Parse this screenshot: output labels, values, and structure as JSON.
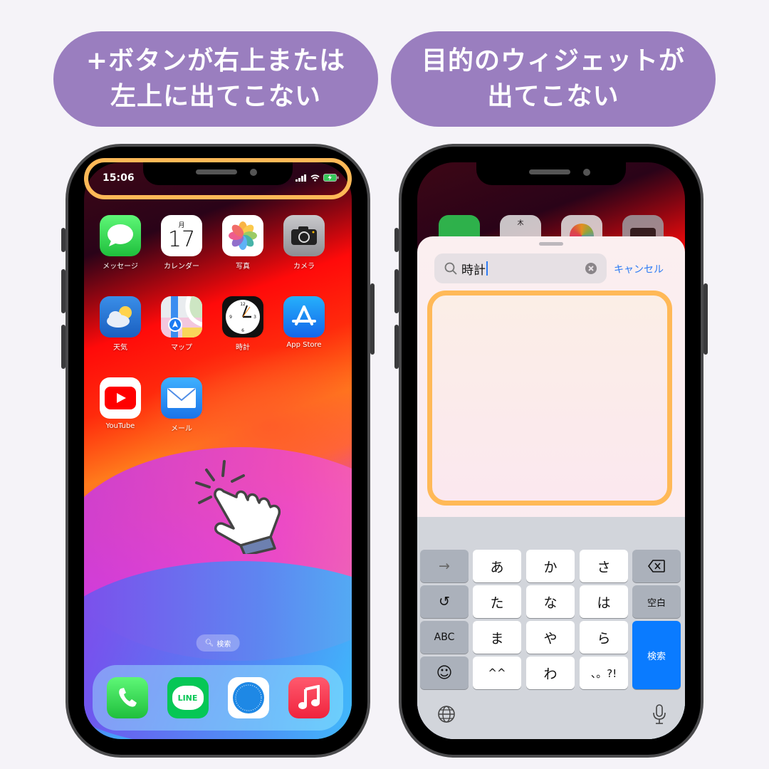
{
  "banners": {
    "left": {
      "line1": "+ボタンが右上または",
      "line2": "左上に出てこない"
    },
    "right": {
      "line1": "目的のウィジェットが",
      "line2": "出てこない"
    }
  },
  "colors": {
    "banner_bg": "#9a7ebf",
    "highlight": "#ffb957",
    "link_blue": "#2d7bf4",
    "search_key_blue": "#0a7bff"
  },
  "phone1": {
    "status_time": "15:06",
    "status_icons": [
      "signal-icon",
      "wifi-icon",
      "battery-charging-icon"
    ],
    "apps": [
      {
        "name": "messages",
        "label": "メッセージ"
      },
      {
        "name": "calendar",
        "label": "カレンダー",
        "day_of_week": "月",
        "date": "17"
      },
      {
        "name": "photos",
        "label": "写真"
      },
      {
        "name": "camera",
        "label": "カメラ"
      },
      {
        "name": "weather",
        "label": "天気"
      },
      {
        "name": "maps",
        "label": "マップ"
      },
      {
        "name": "clock",
        "label": "時計"
      },
      {
        "name": "app-store",
        "label": "App Store"
      },
      {
        "name": "youtube",
        "label": "YouTube"
      },
      {
        "name": "mail",
        "label": "メール"
      }
    ],
    "search_pill": "検索",
    "dock": [
      {
        "name": "phone"
      },
      {
        "name": "line",
        "text": "LINE"
      },
      {
        "name": "safari"
      },
      {
        "name": "music"
      }
    ]
  },
  "phone2": {
    "bg_calendar_day": "木",
    "search": {
      "value": "時計",
      "cancel_label": "キャンセル"
    },
    "keyboard": {
      "rows": [
        [
          "→",
          "あ",
          "か",
          "さ",
          "⌫"
        ],
        [
          "↺",
          "た",
          "な",
          "は",
          "空白"
        ],
        [
          "ABC",
          "ま",
          "や",
          "ら",
          "検索"
        ],
        [
          "☺",
          "^^",
          "わ",
          "、。?!"
        ]
      ],
      "search_key": "検索",
      "space_key": "空白",
      "abc_key": "ABC"
    }
  }
}
